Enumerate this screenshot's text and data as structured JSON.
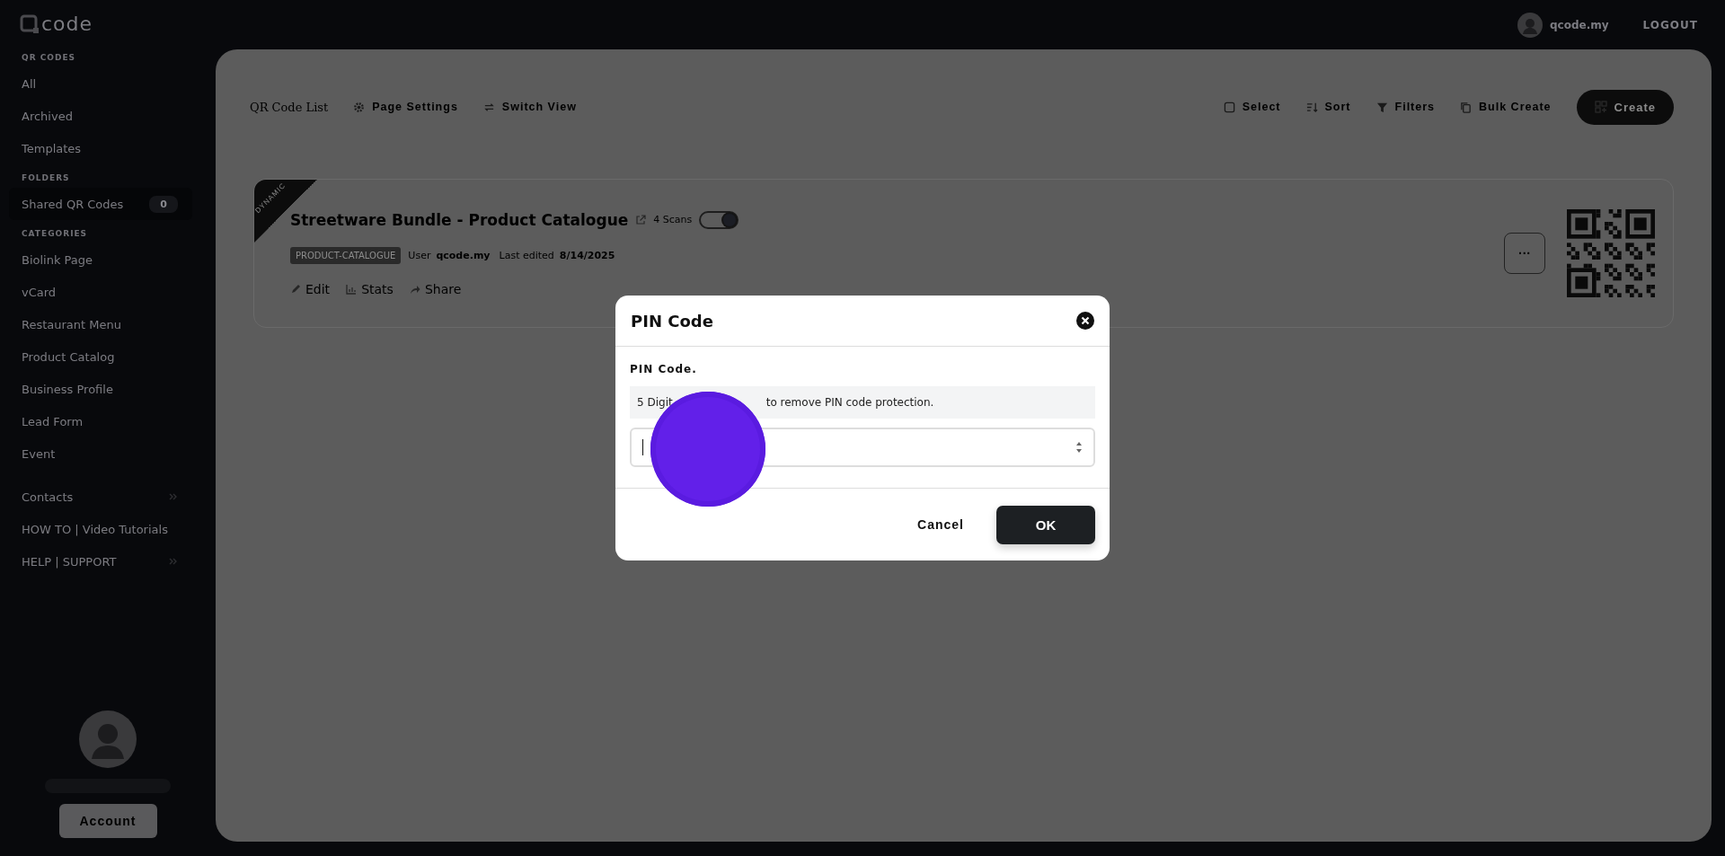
{
  "logo": {
    "text": "code"
  },
  "top_bar": {
    "user": "qcode.my",
    "logout": "LOGOUT"
  },
  "sidebar": {
    "sections": [
      {
        "heading": "QR CODES",
        "items": [
          {
            "label": "All",
            "selected": false
          },
          {
            "label": "Archived",
            "selected": false
          },
          {
            "label": "Templates",
            "selected": false
          }
        ]
      },
      {
        "heading": "FOLDERS",
        "items": [
          {
            "label": "Shared QR Codes",
            "selected": true,
            "count": "0"
          }
        ]
      },
      {
        "heading": "CATEGORIES",
        "items": [
          {
            "label": "Biolink Page",
            "selected": false
          },
          {
            "label": "vCard",
            "selected": false
          },
          {
            "label": "Restaurant Menu",
            "selected": false
          },
          {
            "label": "Product Catalog",
            "selected": false
          },
          {
            "label": "Business Profile",
            "selected": false
          },
          {
            "label": "Lead Form",
            "selected": false
          },
          {
            "label": "Event",
            "selected": false
          }
        ]
      }
    ],
    "links": [
      {
        "label": "Contacts",
        "has_submenu": true
      },
      {
        "label": "HOW TO | Video Tutorials",
        "has_submenu": false
      },
      {
        "label": "HELP | SUPPORT",
        "has_submenu": true
      }
    ],
    "account_button": "Account"
  },
  "toolbar": {
    "title": "QR Code List",
    "left_actions": [
      {
        "label": "Page Settings",
        "kind": "gear"
      },
      {
        "label": "Switch View",
        "kind": "switch"
      }
    ],
    "right_actions": [
      {
        "label": "Select",
        "kind": "select"
      },
      {
        "label": "Sort",
        "kind": "sort"
      },
      {
        "label": "Filters",
        "kind": "filter"
      },
      {
        "label": "Bulk Create",
        "kind": "copy"
      }
    ],
    "create_button": "Create"
  },
  "card": {
    "badge": "DYNAMIC",
    "title": "Streetware Bundle - Product Catalogue",
    "scans": "4 Scans",
    "active": true,
    "tag": "PRODUCT-CATALOGUE",
    "user_label": "User",
    "user": "qcode.my",
    "edited_label": "Last edited",
    "edited": "8/14/2025",
    "actions": [
      {
        "label": "Edit",
        "kind": "edit"
      },
      {
        "label": "Stats",
        "kind": "stats"
      },
      {
        "label": "Share",
        "kind": "share"
      }
    ],
    "more": "···"
  },
  "modal": {
    "title": "PIN Code",
    "field_label": "PIN Code.",
    "help_parts": [
      "5 Digit",
      "to remove PIN code protection."
    ],
    "cancel": "Cancel",
    "ok": "OK"
  }
}
